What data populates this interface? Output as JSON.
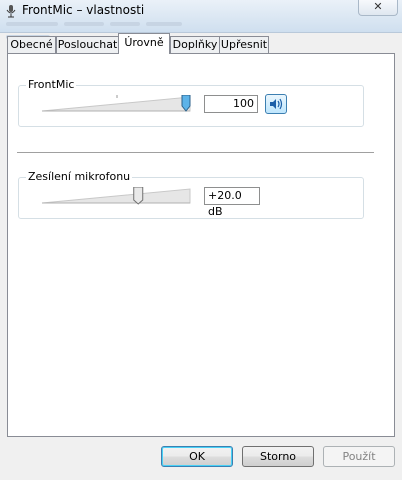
{
  "window": {
    "title": "FrontMic – vlastnosti",
    "close_label": "✕"
  },
  "tabs": [
    {
      "label": "Obecné"
    },
    {
      "label": "Poslouchat"
    },
    {
      "label": "Úrovně"
    },
    {
      "label": "Doplňky"
    },
    {
      "label": "Upřesnit"
    }
  ],
  "active_tab": "Úrovně",
  "frontmic": {
    "label": "FrontMic",
    "value": "100",
    "level_fraction": 1.0
  },
  "boost": {
    "label": "Zesílení mikrofonu",
    "value": "+20.0 dB",
    "level_fraction": 0.66
  },
  "buttons": {
    "ok": "OK",
    "cancel": "Storno",
    "apply": "Použít"
  },
  "colors": {
    "accent": "#3c7fb1",
    "thumb": "#5db3e8"
  }
}
